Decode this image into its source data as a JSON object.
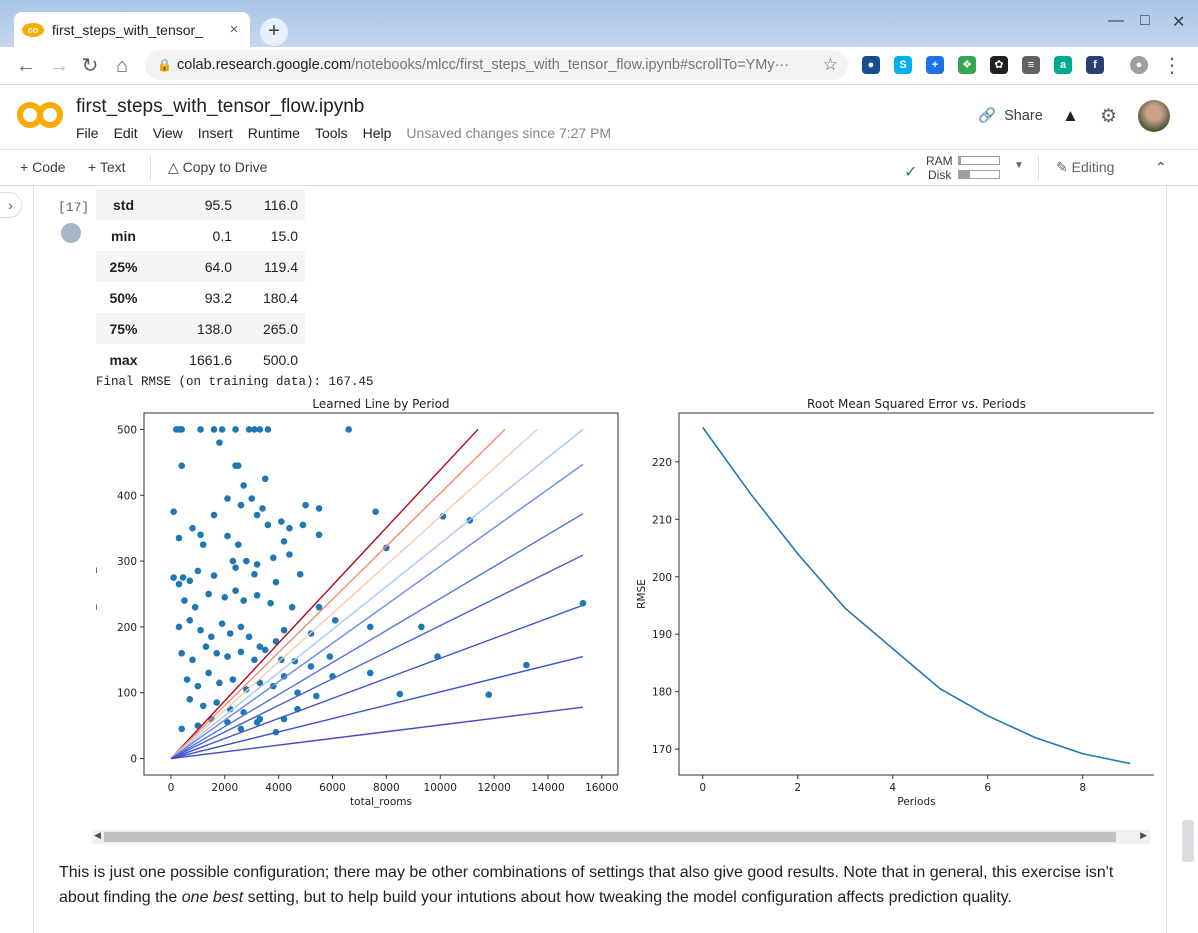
{
  "browser": {
    "tab_title": "first_steps_with_tensor_",
    "tab_close": "×",
    "new_tab": "+",
    "url_host": "colab.research.google.com",
    "url_path": "/notebooks/mlcc/first_steps_with_tensor_flow.ipynb#scrollTo=YMy···"
  },
  "header": {
    "notebook_title": "first_steps_with_tensor_flow.ipynb",
    "menus": [
      "File",
      "Edit",
      "View",
      "Insert",
      "Runtime",
      "Tools",
      "Help"
    ],
    "unsaved": "Unsaved changes since 7:27 PM",
    "share_label": "Share"
  },
  "toolbar": {
    "code_label": "Code",
    "text_label": "Text",
    "copy_label": "Copy to Drive",
    "ram_label": "RAM",
    "disk_label": "Disk",
    "ram_fraction": 0.05,
    "disk_fraction": 0.28,
    "editing_label": "Editing"
  },
  "cell": {
    "exec_count": "[17]",
    "stats_rows": [
      {
        "label": "std",
        "v1": "95.5",
        "v2": "116.0"
      },
      {
        "label": "min",
        "v1": "0.1",
        "v2": "15.0"
      },
      {
        "label": "25%",
        "v1": "64.0",
        "v2": "119.4"
      },
      {
        "label": "50%",
        "v1": "93.2",
        "v2": "180.4"
      },
      {
        "label": "75%",
        "v1": "138.0",
        "v2": "265.0"
      },
      {
        "label": "max",
        "v1": "1661.6",
        "v2": "500.0"
      }
    ],
    "final_rmse": "Final RMSE (on training data): 167.45"
  },
  "chart_data": [
    {
      "type": "scatter",
      "title": "Learned Line by Period",
      "xlabel": "total_rooms",
      "ylabel": "median_house_value",
      "xlim": [
        -1000,
        16600
      ],
      "ylim": [
        -25,
        525
      ],
      "xticks": [
        0,
        2000,
        4000,
        6000,
        8000,
        10000,
        12000,
        14000,
        16000
      ],
      "yticks": [
        0,
        100,
        200,
        300,
        400,
        500
      ],
      "grid": false,
      "point_color": "#1f77b4",
      "points": [
        [
          200,
          500
        ],
        [
          300,
          500
        ],
        [
          400,
          500
        ],
        [
          1100,
          500
        ],
        [
          1600,
          500
        ],
        [
          1900,
          500
        ],
        [
          2400,
          500
        ],
        [
          2900,
          500
        ],
        [
          3100,
          500
        ],
        [
          3300,
          500
        ],
        [
          3600,
          500
        ],
        [
          6600,
          500
        ],
        [
          400,
          445
        ],
        [
          2400,
          445
        ],
        [
          1800,
          480
        ],
        [
          2500,
          445
        ],
        [
          2700,
          415
        ],
        [
          3500,
          425
        ],
        [
          2100,
          395
        ],
        [
          2600,
          385
        ],
        [
          3400,
          380
        ],
        [
          3000,
          395
        ],
        [
          100,
          375
        ],
        [
          1600,
          370
        ],
        [
          3200,
          370
        ],
        [
          3600,
          355
        ],
        [
          4100,
          360
        ],
        [
          5000,
          385
        ],
        [
          5500,
          380
        ],
        [
          7600,
          375
        ],
        [
          10100,
          368
        ],
        [
          11100,
          362
        ],
        [
          800,
          350
        ],
        [
          300,
          335
        ],
        [
          1100,
          340
        ],
        [
          1200,
          325
        ],
        [
          2100,
          338
        ],
        [
          2500,
          325
        ],
        [
          4200,
          330
        ],
        [
          4400,
          350
        ],
        [
          4900,
          355
        ],
        [
          5500,
          340
        ],
        [
          2300,
          300
        ],
        [
          2800,
          300
        ],
        [
          3200,
          295
        ],
        [
          3800,
          305
        ],
        [
          4400,
          310
        ],
        [
          8000,
          320
        ],
        [
          100,
          275
        ],
        [
          300,
          265
        ],
        [
          450,
          275
        ],
        [
          700,
          270
        ],
        [
          1000,
          285
        ],
        [
          1600,
          278
        ],
        [
          2400,
          290
        ],
        [
          3100,
          280
        ],
        [
          3900,
          268
        ],
        [
          4800,
          280
        ],
        [
          500,
          240
        ],
        [
          900,
          230
        ],
        [
          1400,
          250
        ],
        [
          2000,
          245
        ],
        [
          2400,
          255
        ],
        [
          2700,
          240
        ],
        [
          3200,
          248
        ],
        [
          3700,
          236
        ],
        [
          4500,
          230
        ],
        [
          5500,
          230
        ],
        [
          300,
          200
        ],
        [
          700,
          210
        ],
        [
          1100,
          195
        ],
        [
          1500,
          185
        ],
        [
          1900,
          205
        ],
        [
          2200,
          190
        ],
        [
          2600,
          200
        ],
        [
          2900,
          185
        ],
        [
          3300,
          170
        ],
        [
          3900,
          178
        ],
        [
          4200,
          195
        ],
        [
          5200,
          190
        ],
        [
          6100,
          210
        ],
        [
          7400,
          200
        ],
        [
          9300,
          200
        ],
        [
          400,
          160
        ],
        [
          800,
          150
        ],
        [
          1300,
          170
        ],
        [
          1700,
          160
        ],
        [
          2100,
          155
        ],
        [
          2600,
          162
        ],
        [
          3100,
          150
        ],
        [
          3500,
          165
        ],
        [
          4100,
          150
        ],
        [
          4600,
          148
        ],
        [
          5200,
          140
        ],
        [
          5900,
          155
        ],
        [
          9900,
          155
        ],
        [
          13200,
          142
        ],
        [
          600,
          120
        ],
        [
          1000,
          110
        ],
        [
          1400,
          130
        ],
        [
          1800,
          115
        ],
        [
          2300,
          120
        ],
        [
          2800,
          105
        ],
        [
          3300,
          115
        ],
        [
          3800,
          110
        ],
        [
          4200,
          125
        ],
        [
          4700,
          100
        ],
        [
          5400,
          95
        ],
        [
          6000,
          125
        ],
        [
          7400,
          130
        ],
        [
          700,
          90
        ],
        [
          1200,
          80
        ],
        [
          1700,
          85
        ],
        [
          2200,
          75
        ],
        [
          2700,
          70
        ],
        [
          3300,
          60
        ],
        [
          4200,
          60
        ],
        [
          4700,
          75
        ],
        [
          8500,
          98
        ],
        [
          11800,
          97
        ],
        [
          15300,
          236
        ],
        [
          400,
          45
        ],
        [
          1000,
          50
        ],
        [
          1500,
          60
        ],
        [
          2100,
          55
        ],
        [
          2600,
          45
        ],
        [
          3200,
          55
        ],
        [
          3900,
          40
        ]
      ],
      "lines": [
        {
          "x_end": 11400,
          "y_end": 500,
          "color": "#b40426"
        },
        {
          "x_end": 12400,
          "y_end": 500,
          "color": "#f08b6e"
        },
        {
          "x_end": 13600,
          "y_end": 500,
          "color": "#f0cbb4"
        },
        {
          "x_end": 15300,
          "y_end": 500,
          "color": "#aac7fd"
        },
        {
          "x_end": 15300,
          "y_end": 447,
          "color": "#6788ee"
        },
        {
          "x_end": 15300,
          "y_end": 372,
          "color": "#5572df"
        },
        {
          "x_end": 15300,
          "y_end": 309,
          "color": "#4a63d3"
        },
        {
          "x_end": 15300,
          "y_end": 233,
          "color": "#4358cb"
        },
        {
          "x_end": 15300,
          "y_end": 155,
          "color": "#3e51c5"
        },
        {
          "x_end": 15300,
          "y_end": 78,
          "color": "#3b4cc0"
        }
      ]
    },
    {
      "type": "line",
      "title": "Root Mean Squared Error vs. Periods",
      "xlabel": "Periods",
      "ylabel": "RMSE",
      "xlim": [
        -0.5,
        9.5
      ],
      "ylim": [
        165.5,
        228.5
      ],
      "xticks": [
        0,
        2,
        4,
        6,
        8
      ],
      "yticks": [
        170,
        180,
        190,
        200,
        210,
        220
      ],
      "grid": false,
      "series": [
        {
          "color": "#1f77b4",
          "x": [
            0,
            1,
            2,
            3,
            4,
            5,
            6,
            7,
            8,
            9
          ],
          "values": [
            226.0,
            214.5,
            204.0,
            194.5,
            187.5,
            180.5,
            175.8,
            172.0,
            169.2,
            167.5
          ]
        }
      ]
    }
  ],
  "paragraph": {
    "text1": "This is just one possible configuration; there may be other combinations of settings that also give good results. Note that in general, this exercise isn't about finding the ",
    "emph": "one best",
    "text2": " setting, but to help build your intutions about how tweaking the model configuration affects prediction quality."
  }
}
